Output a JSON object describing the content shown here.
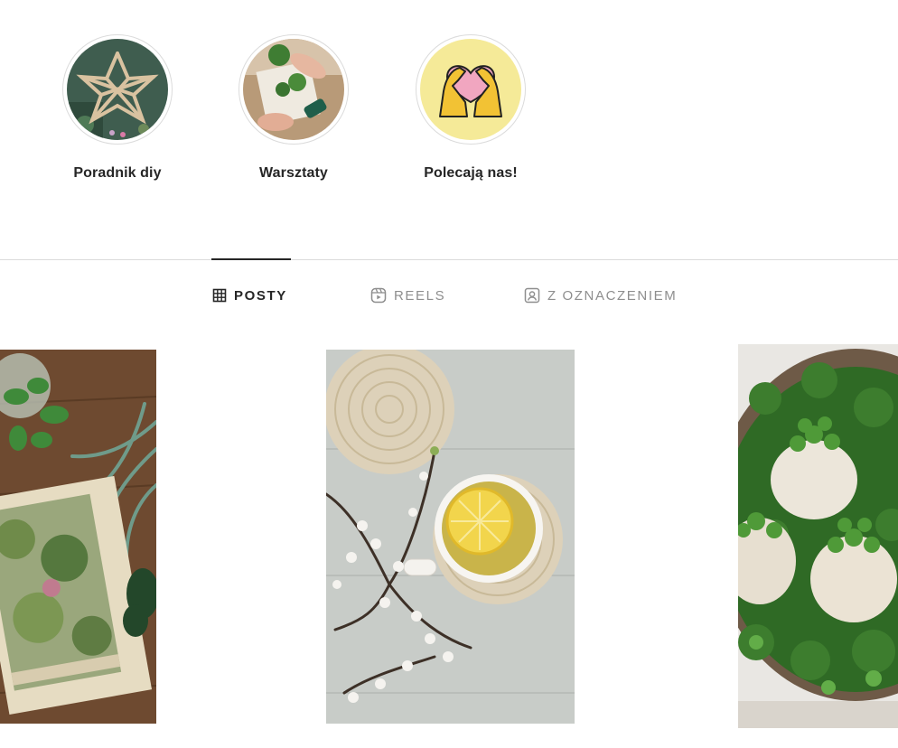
{
  "highlights": [
    {
      "label": "Poradnik diy",
      "icon": "star-craft-thumbnail"
    },
    {
      "label": "Warsztaty",
      "icon": "workshop-hands-thumbnail"
    },
    {
      "label": "Polecają nas!",
      "icon": "heart-hands-thumbnail"
    }
  ],
  "tabs": [
    {
      "label": "POSTY",
      "icon": "grid-icon",
      "active": true
    },
    {
      "label": "REELS",
      "icon": "reels-icon",
      "active": false
    },
    {
      "label": "Z OZNACZENIEM",
      "icon": "tagged-icon",
      "active": false
    }
  ],
  "posts": [
    {
      "subject": "botanical-book-succulents"
    },
    {
      "subject": "lemon-tea-blossom"
    },
    {
      "subject": "eggshell-sprouts-moss"
    }
  ],
  "colors": {
    "text": "#262626",
    "muted": "#8e8e8e",
    "border": "#dbdbdb"
  }
}
